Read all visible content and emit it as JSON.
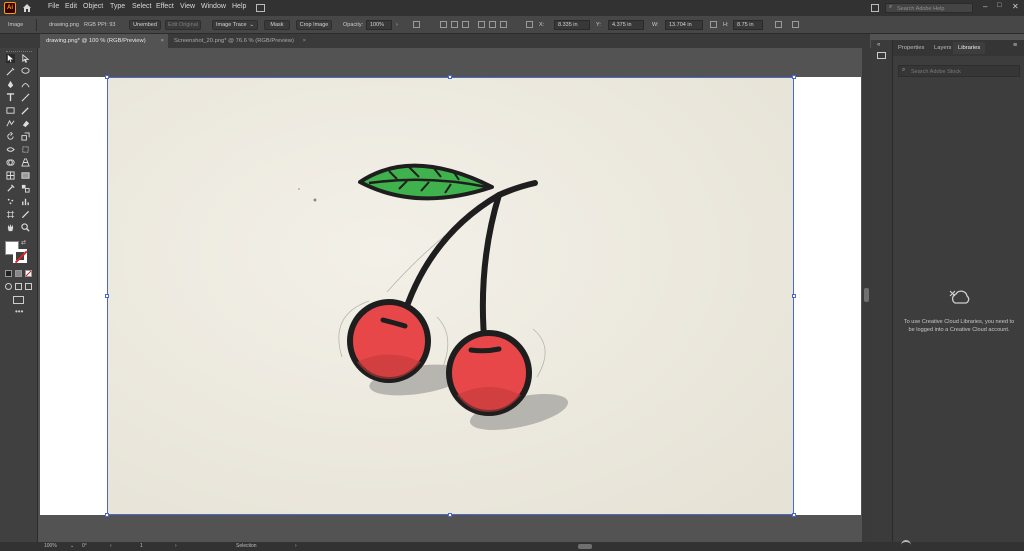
{
  "app": {
    "logo_text": "Ai"
  },
  "menus": [
    "File",
    "Edit",
    "Object",
    "Type",
    "Select",
    "Effect",
    "View",
    "Window",
    "Help"
  ],
  "search": {
    "placeholder": "Search Adobe Help"
  },
  "control_bar": {
    "selection_type": "Image",
    "filename": "drawing.png",
    "color_mode": "RGB  PPI: 93",
    "embed_label": "Unembed",
    "edit_original_label": "Edit Original",
    "image_trace_label": "Image Trace",
    "mask_label": "Mask",
    "crop_label": "Crop Image",
    "opacity_label": "Opacity:",
    "opacity_value": "100%",
    "x_label": "X:",
    "x_value": "8.335 in",
    "y_label": "Y:",
    "y_value": "4.375 in",
    "w_label": "W:",
    "w_value": "13.704 in",
    "h_label": "H:",
    "h_value": "8.75 in"
  },
  "tabs": [
    {
      "label": "drawing.png* @ 100 % (RGB/Preview)",
      "active": true
    },
    {
      "label": "Screenshot_20.png* @ 76.6 % (RGB/Preview)",
      "active": false
    }
  ],
  "panel": {
    "tabs": [
      "Properties",
      "Layers",
      "Libraries"
    ],
    "active_tab": "Libraries",
    "search_placeholder": "Search Adobe Stock",
    "message": "To use Creative Cloud Libraries, you need to be logged into a Creative Cloud account."
  },
  "status": {
    "zoom": "100%",
    "rotation": "0°",
    "artboard_number": "1",
    "tool_name": "Selection"
  },
  "colors": {
    "accent": "#4b69c9",
    "leaf": "#3fb24d",
    "cherry": "#e8474a"
  },
  "icons": [
    "home-icon",
    "search-icon",
    "creative-cloud-icon",
    "selection-tool-icon",
    "pen-tool-icon",
    "type-tool-icon",
    "hand-tool-icon",
    "zoom-tool-icon"
  ]
}
